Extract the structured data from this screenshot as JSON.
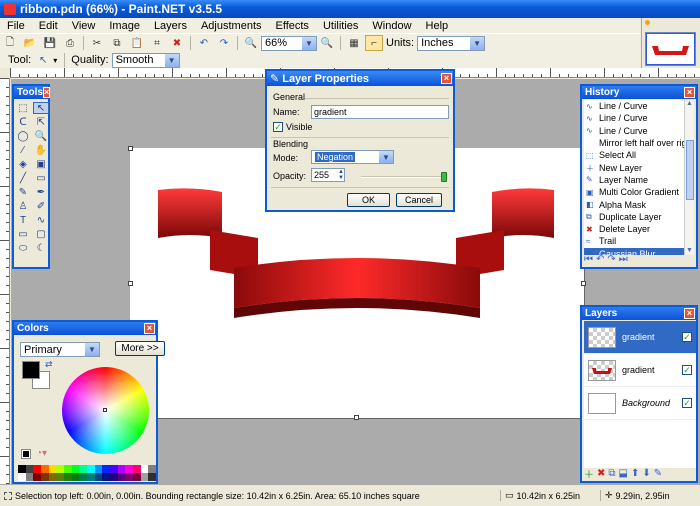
{
  "window": {
    "title": "ribbon.pdn (66%) - Paint.NET v3.5.5"
  },
  "menu": [
    "File",
    "Edit",
    "View",
    "Image",
    "Layers",
    "Adjustments",
    "Effects",
    "Utilities",
    "Window",
    "Help"
  ],
  "toolbar": {
    "zoom_value": "66%",
    "units_label": "Units:",
    "units_value": "Inches",
    "tool_label": "Tool:",
    "quality_label": "Quality:",
    "quality_value": "Smooth"
  },
  "tools_panel": {
    "title": "Tools"
  },
  "history_panel": {
    "title": "History",
    "items": [
      {
        "label": "Line / Curve",
        "icon": "curve-icon"
      },
      {
        "label": "Line / Curve",
        "icon": "curve-icon"
      },
      {
        "label": "Line / Curve",
        "icon": "curve-icon"
      },
      {
        "label": "Mirror left half over right ...",
        "icon": ""
      },
      {
        "label": "Select All",
        "icon": "select-all-icon"
      },
      {
        "label": "New Layer",
        "icon": "new-layer-icon"
      },
      {
        "label": "Layer Name",
        "icon": "layer-properties-icon"
      },
      {
        "label": "Multi Color Gradient",
        "icon": "gradient-icon"
      },
      {
        "label": "Alpha Mask",
        "icon": "alpha-mask-icon"
      },
      {
        "label": "Duplicate Layer",
        "icon": "duplicate-layer-icon"
      },
      {
        "label": "Delete Layer",
        "icon": "delete-layer-icon"
      },
      {
        "label": "Trail",
        "icon": "trail-icon"
      },
      {
        "label": "Gaussian Blur",
        "icon": "blur-icon"
      }
    ],
    "selected_index": 12
  },
  "layers_panel": {
    "title": "Layers",
    "items": [
      {
        "name": "gradient",
        "visible": true,
        "selected": true
      },
      {
        "name": "gradient",
        "visible": true,
        "selected": false
      },
      {
        "name": "Background",
        "visible": true,
        "selected": false
      }
    ]
  },
  "colors_panel": {
    "title": "Colors",
    "mode_value": "Primary",
    "more_label": "More >>",
    "primary_color": "#000000",
    "secondary_color": "#FFFFFF",
    "palette": [
      "#000000",
      "#404040",
      "#FF0000",
      "#FF6A00",
      "#FFD800",
      "#B6FF00",
      "#4CFF00",
      "#00FF21",
      "#00FF90",
      "#00FFFF",
      "#0094FF",
      "#0026FF",
      "#4800FF",
      "#B200FF",
      "#FF00DC",
      "#FF006E",
      "#FFFFFF",
      "#808080",
      "#FFFFFF",
      "#808080",
      "#7F0000",
      "#7F3300",
      "#7F6A00",
      "#5B7F00",
      "#267F00",
      "#007F0E",
      "#007F46",
      "#007F7F",
      "#004A7F",
      "#00137F",
      "#21007F",
      "#57007F",
      "#7F006E",
      "#7F0037",
      "#A0A0A0",
      "#303030"
    ]
  },
  "layer_properties_dialog": {
    "title": "Layer Properties",
    "general_label": "General",
    "name_label": "Name:",
    "name_value": "gradient",
    "visible_label": "Visible",
    "visible_checked": true,
    "blending_label": "Blending",
    "mode_label": "Mode:",
    "mode_value": "Negation",
    "opacity_label": "Opacity:",
    "opacity_value": "255",
    "opacity_fraction": 1.0,
    "ok_label": "OK",
    "cancel_label": "Cancel"
  },
  "status_bar": {
    "selection_text": "Selection top left: 0.00in, 0.00in. Bounding rectangle size: 10.42in x 6.25in. Area: 65.10 inches square",
    "size_text": "10.42in x 6.25in",
    "cursor_text": "9.29in, 2.95in"
  },
  "colors": {
    "accent": "#0A5BD8",
    "selection": "#316AC5",
    "ribbon": "#D41616"
  }
}
